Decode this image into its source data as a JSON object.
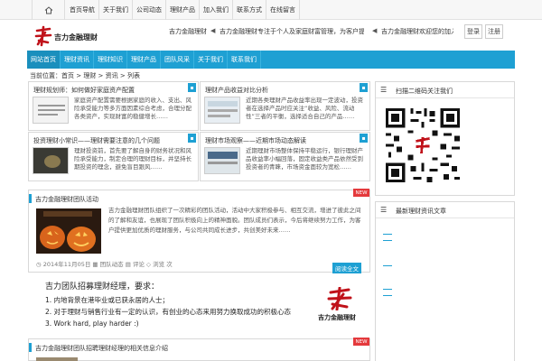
{
  "topnav": {
    "items": [
      "首页导航",
      "关于我们",
      "公司动态",
      "理财产品",
      "加入我们",
      "联系方式",
      "在线留言"
    ]
  },
  "header": {
    "brand": "吉力金融理财",
    "notice_1": "吉力金融理财欢迎您——",
    "notice_2": "吉力金融理财专注于个人及家庭财富管理，为客户提供专业的投资理财建议和服务。",
    "notice_3": "吉力金融理财欢迎您的加入和咨询！",
    "btn_login": "登录",
    "btn_reg": "注册"
  },
  "mainnav": {
    "items": [
      "网站首页",
      "理财资讯",
      "理财知识",
      "理财产品",
      "团队风采",
      "关于我们",
      "联系我们"
    ]
  },
  "breadcrumb": "当前位置：首页 > 理财 > 资讯 > 列表",
  "cards": [
    {
      "title": "理财规划师：如何做好家庭资产配置",
      "desc": "家庭资产配置需要根据家庭的收入、支出、风险承受能力等多方面因素综合考虑，合理分配各类资产，实现财富的稳健增长……"
    },
    {
      "title": "理财产品收益对比分析",
      "desc": "近期各类理财产品收益率出现一定波动，投资者在选择产品时应关注“收益、风险、流动性”三者的平衡，选择适合自己的产品……"
    },
    {
      "title": "投资理财小常识——理财需要注意的几个问题",
      "desc": "理财投资前，首先要了解自身的财务状况和风险承受能力，制定合理的理财目标，并坚持长期投资的理念，避免盲目跟风……"
    },
    {
      "title": "理财市场观察——近期市场动态解读",
      "desc": "近期理财市场整体保持平稳运行，银行理财产品收益率小幅回落，固定收益类产品依然受到投资者的青睐，市场资金面较为宽松……"
    }
  ],
  "featured": {
    "section_title": "吉力金融理财团队活动",
    "new_label": "NEW",
    "body": "吉力金融理财团队组织了一次精彩的团队活动，活动中大家积极参与、相互交流，增进了彼此之间的了解和友谊，也展现了团队积极向上的精神面貌。团队成员们表示，今后将继续努力工作，为客户提供更加优质的理财服务，与公司共同成长进步，共创美好未来……",
    "meta_date": "2014年11月05日",
    "meta_cat": "团队动态",
    "meta_comment": "评论",
    "meta_views": "浏览 次",
    "more": "阅读全文"
  },
  "recruit": {
    "heading": "吉力团队招募理财经理，要求：",
    "lines": [
      "1. 内地背景在港毕业或已获永居的人士；",
      "2. 对于理财与销售行业有一定的认识，有创业的心态来用努力换取成功的积极心态",
      "3. Work hard, play harder :)"
    ]
  },
  "last": {
    "section_title": "吉力金融理财团队招聘理财经理的相关信息介绍",
    "new_label": "NEW"
  },
  "sidebar": {
    "qr_title": "扫描二维码关注我们",
    "links_title": "最新理财资讯文章"
  },
  "colors": {
    "accent": "#1ea0d3",
    "new_tag": "#e4393c"
  }
}
